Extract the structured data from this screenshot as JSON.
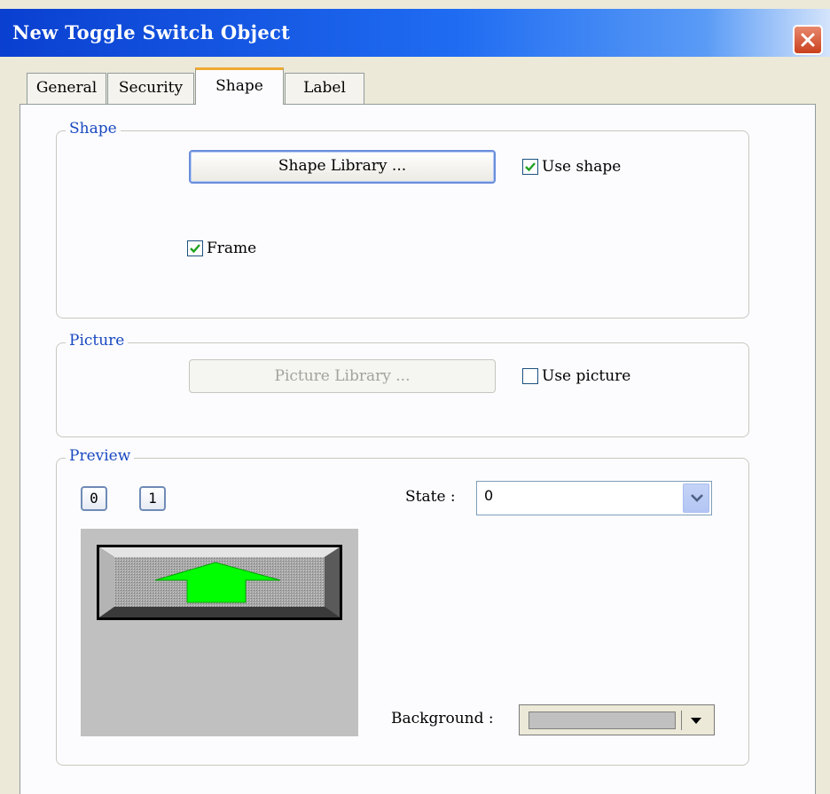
{
  "window": {
    "title": "New  Toggle Switch Object"
  },
  "tabs": [
    {
      "label": "General",
      "active": false
    },
    {
      "label": "Security",
      "active": false
    },
    {
      "label": "Shape",
      "active": true
    },
    {
      "label": "Label",
      "active": false
    }
  ],
  "shape_group": {
    "label": "Shape",
    "library_button": "Shape Library ...",
    "use_shape": {
      "label": "Use shape",
      "checked": true
    },
    "frame": {
      "label": "Frame",
      "checked": true
    }
  },
  "picture_group": {
    "label": "Picture",
    "library_button": "Picture Library ...",
    "use_picture": {
      "label": "Use picture",
      "checked": false
    }
  },
  "preview_group": {
    "label": "Preview",
    "state_buttons": [
      "0",
      "1"
    ],
    "state_label": "State :",
    "state_value": "0",
    "background_label": "Background :",
    "background_color": "#c0c0c0"
  },
  "colors": {
    "titlebar": "#0a3fd0",
    "arrow_fill": "#00ff00",
    "active_tab_accent": "#f0a830",
    "group_label": "#1848c0"
  }
}
